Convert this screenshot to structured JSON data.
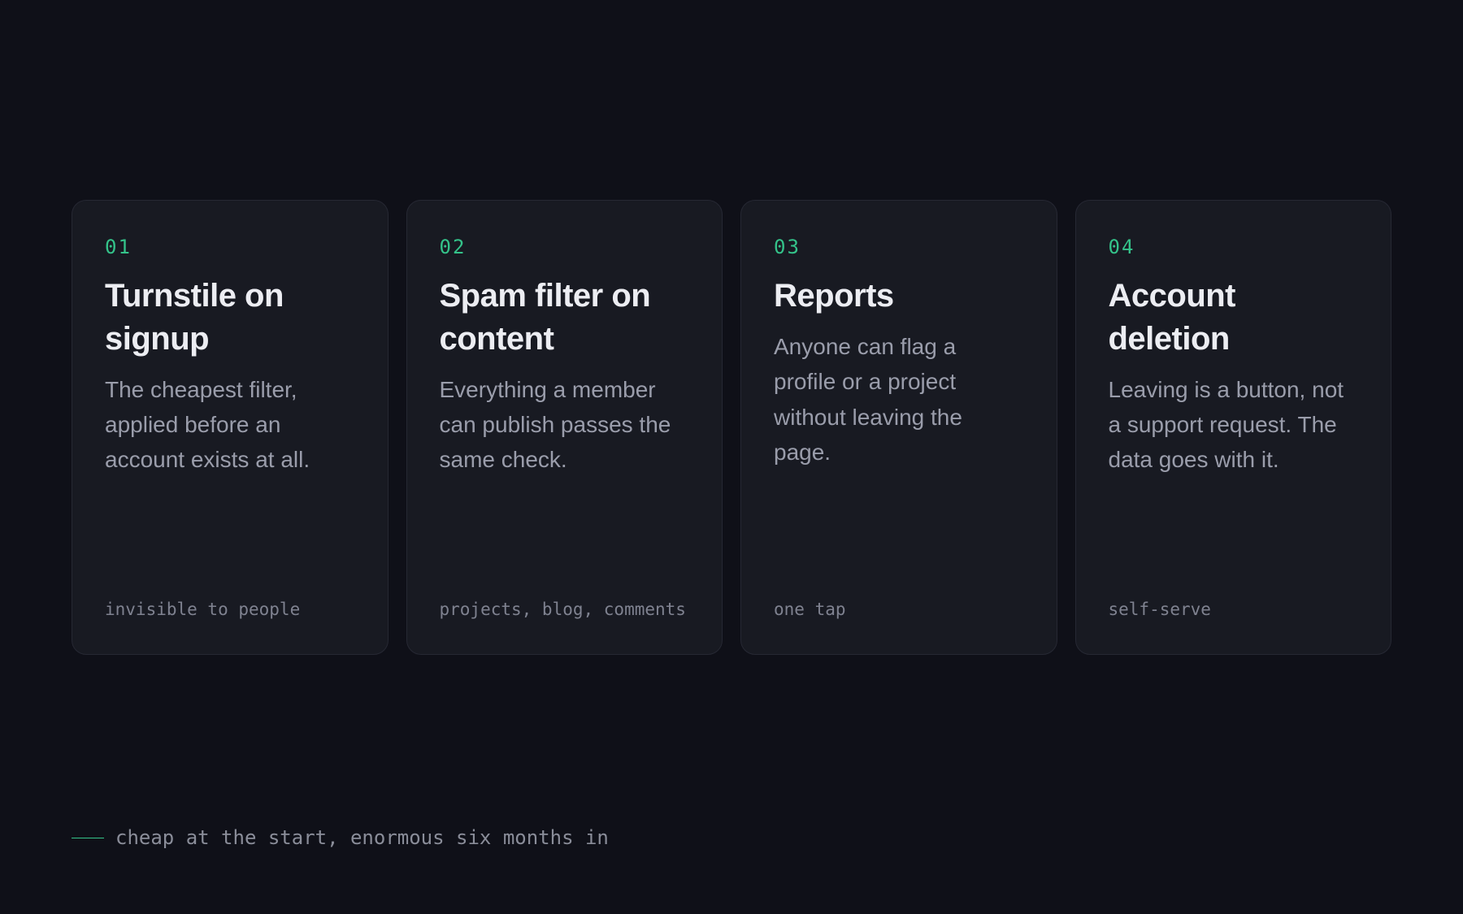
{
  "cards": [
    {
      "number": "01",
      "title": "Turnstile on signup",
      "description": "The cheapest filter, applied before an account exists at all.",
      "tag": "invisible to people"
    },
    {
      "number": "02",
      "title": "Spam filter on content",
      "description": "Everything a member can publish passes the same check.",
      "tag": "projects, blog, comments"
    },
    {
      "number": "03",
      "title": "Reports",
      "description": "Anyone can flag a profile or a project without leaving the page.",
      "tag": "one tap"
    },
    {
      "number": "04",
      "title": "Account deletion",
      "description": "Leaving is a button, not a support request. The data goes with it.",
      "tag": "self-serve"
    }
  ],
  "footer": {
    "text": "cheap at the start, enormous six months in"
  },
  "colors": {
    "background": "#0f1018",
    "card": "#181a22",
    "accent": "#34c38a",
    "title": "#ecedf2",
    "body": "#9a9dab",
    "muted": "#7f8290"
  }
}
